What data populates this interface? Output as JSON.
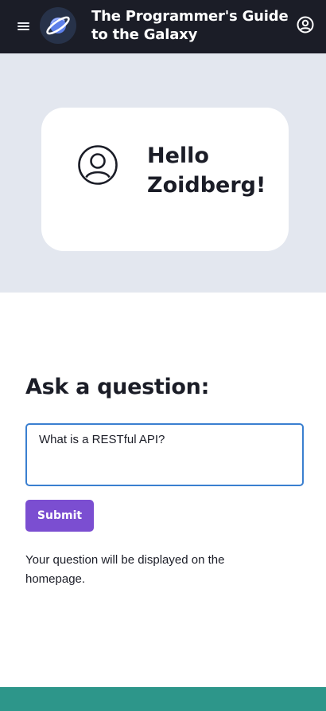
{
  "header": {
    "title": "The Programmer's Guide to the Galaxy",
    "menu_icon": "hamburger-menu-icon",
    "logo_icon": "planet-logo-icon",
    "account_icon": "user-account-icon"
  },
  "hero": {
    "greeting": "Hello Zoidberg!",
    "avatar_icon": "user-avatar-icon"
  },
  "question_form": {
    "heading": "Ask a question:",
    "input_value": "What is a RESTful API?",
    "submit_label": "Submit",
    "hint": "Your question will be displayed on the homepage."
  },
  "colors": {
    "topbar": "#1b1d27",
    "hero_bg": "#e3e7ef",
    "submit": "#7b4ed1",
    "input_border": "#3a7fd0",
    "footer": "#2d968a"
  }
}
